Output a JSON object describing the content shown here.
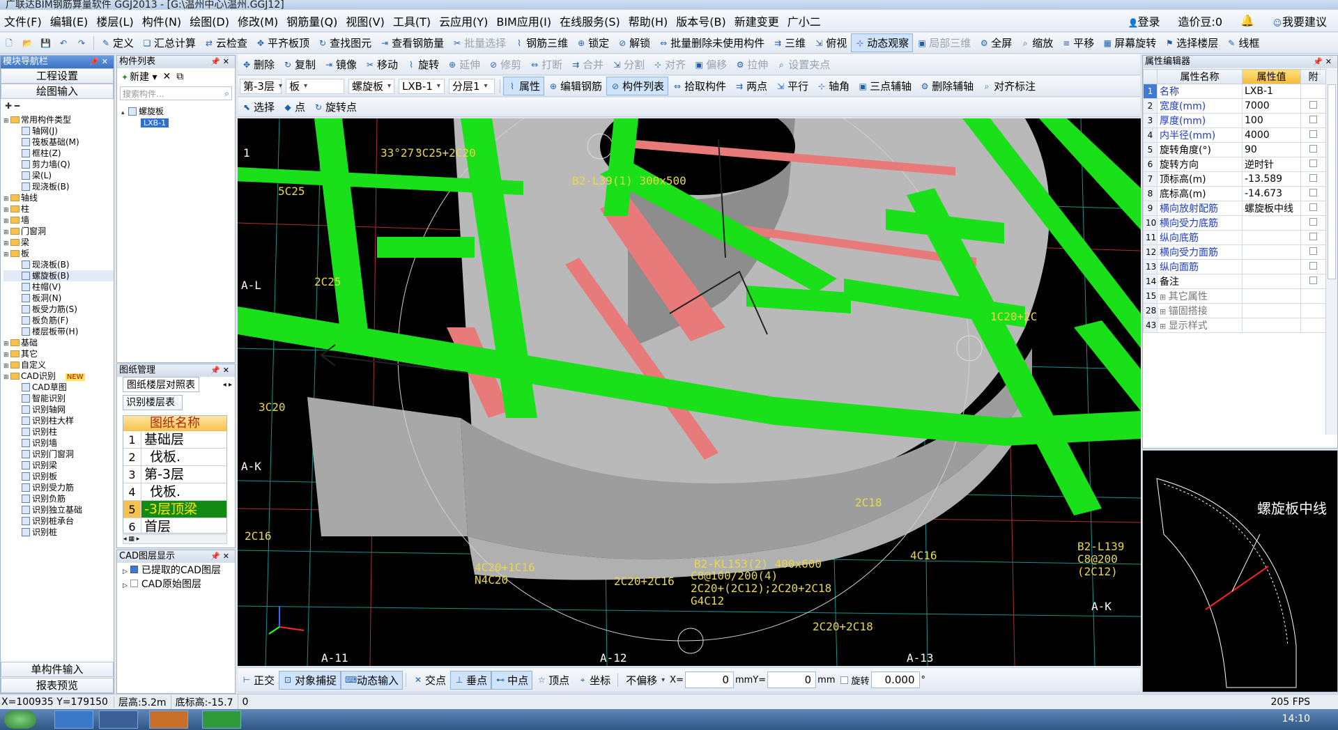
{
  "window": {
    "title": "广联达BIM钢筋算量软件 GGJ2013 - [G:\\温州中心\\温州.GGJ12]"
  },
  "menu": [
    "文件(F)",
    "编辑(E)",
    "楼层(L)",
    "构件(N)",
    "绘图(D)",
    "修改(M)",
    "钢筋量(Q)",
    "视图(V)",
    "工具(T)",
    "云应用(Y)",
    "BIM应用(I)",
    "在线服务(S)",
    "帮助(H)",
    "版本号(B)",
    "新建变更",
    "广小二"
  ],
  "menu_right": {
    "login": "登录",
    "price_bean": "造价豆:0",
    "suggest": "我要建议"
  },
  "toolbar1": [
    "定义",
    "汇总计算",
    "云检查",
    "平齐板顶",
    "查找图元",
    "查看钢筋量",
    "批量选择",
    "钢筋三维",
    "锁定",
    "解锁",
    "批量删除未使用构件",
    "三维",
    "俯视",
    "动态观察",
    "局部三维",
    "全屏",
    "缩放",
    "平移",
    "屏幕旋转",
    "选择楼层",
    "线框"
  ],
  "toolbar2": [
    "删除",
    "复制",
    "镜像",
    "移动",
    "旋转",
    "延伸",
    "修剪",
    "打断",
    "合并",
    "分割",
    "对齐",
    "偏移",
    "拉伸",
    "设置夹点"
  ],
  "toolbar3": {
    "floor": "第-3层",
    "type": "板",
    "subtype": "螺旋板",
    "component": "LXB-1",
    "layer": "分层1",
    "buttons": [
      "属性",
      "编辑钢筋",
      "构件列表",
      "拾取构件",
      "两点",
      "平行",
      "轴角",
      "三点辅轴",
      "删除辅轴",
      "对齐标注"
    ]
  },
  "toolbar4": [
    "选择",
    "点",
    "旋转点"
  ],
  "nav": {
    "title": "模块导航栏",
    "btn1": "工程设置",
    "btn2": "绘图输入",
    "btn3": "单构件输入",
    "btn4": "报表预览",
    "tree": [
      {
        "d": 0,
        "t": "常用构件类型",
        "f": 1
      },
      {
        "d": 1,
        "t": "轴网(J)"
      },
      {
        "d": 1,
        "t": "筏板基础(M)"
      },
      {
        "d": 1,
        "t": "框柱(Z)"
      },
      {
        "d": 1,
        "t": "剪力墙(Q)"
      },
      {
        "d": 1,
        "t": "梁(L)"
      },
      {
        "d": 1,
        "t": "现浇板(B)"
      },
      {
        "d": 0,
        "t": "轴线",
        "f": 1
      },
      {
        "d": 0,
        "t": "柱",
        "f": 1
      },
      {
        "d": 0,
        "t": "墙",
        "f": 1
      },
      {
        "d": 0,
        "t": "门窗洞",
        "f": 1
      },
      {
        "d": 0,
        "t": "梁",
        "f": 1
      },
      {
        "d": 0,
        "t": "板",
        "f": 1
      },
      {
        "d": 1,
        "t": "现浇板(B)"
      },
      {
        "d": 1,
        "t": "螺旋板(B)"
      },
      {
        "d": 1,
        "t": "柱帽(V)"
      },
      {
        "d": 1,
        "t": "板洞(N)"
      },
      {
        "d": 1,
        "t": "板受力筋(S)"
      },
      {
        "d": 1,
        "t": "板负筋(F)"
      },
      {
        "d": 1,
        "t": "楼层板带(H)"
      },
      {
        "d": 0,
        "t": "基础",
        "f": 1
      },
      {
        "d": 0,
        "t": "其它",
        "f": 1
      },
      {
        "d": 0,
        "t": "自定义",
        "f": 1
      },
      {
        "d": 0,
        "t": "CAD识别",
        "f": 1
      },
      {
        "d": 1,
        "t": "CAD草图"
      },
      {
        "d": 1,
        "t": "智能识别"
      },
      {
        "d": 1,
        "t": "识别轴网"
      },
      {
        "d": 1,
        "t": "识别柱大样"
      },
      {
        "d": 1,
        "t": "识别柱"
      },
      {
        "d": 1,
        "t": "识别墙"
      },
      {
        "d": 1,
        "t": "识别门窗洞"
      },
      {
        "d": 1,
        "t": "识别梁"
      },
      {
        "d": 1,
        "t": "识别板"
      },
      {
        "d": 1,
        "t": "识别受力筋"
      },
      {
        "d": 1,
        "t": "识别负筋"
      },
      {
        "d": 1,
        "t": "识别独立基础"
      },
      {
        "d": 1,
        "t": "识别桩承台"
      },
      {
        "d": 1,
        "t": "识别桩"
      }
    ],
    "new_badge": "NEW"
  },
  "complist": {
    "title": "构件列表",
    "new": "新建",
    "search_ph": "搜索构件...",
    "root": "螺旋板",
    "item": "LXB-1"
  },
  "drawings": {
    "title": "图纸管理",
    "tab": "图纸楼层对照表",
    "btn": "识别楼层表",
    "header": "图纸名称",
    "rows": [
      {
        "n": "1",
        "t": "基础层"
      },
      {
        "n": "2",
        "t": "伐板."
      },
      {
        "n": "3",
        "t": "第-3层"
      },
      {
        "n": "4",
        "t": "伐板."
      },
      {
        "n": "5",
        "t": "-3层顶梁"
      },
      {
        "n": "6",
        "t": "首层"
      }
    ]
  },
  "cadlayers": {
    "title": "CAD图层显示",
    "l1": "已提取的CAD图层",
    "l2": "CAD原始图层"
  },
  "props": {
    "title": "属性编辑器",
    "h_name": "属性名称",
    "h_val": "属性值",
    "h_add": "附",
    "rows": [
      {
        "n": "1",
        "k": "名称",
        "v": "LXB-1",
        "c": "blue"
      },
      {
        "n": "2",
        "k": "宽度(mm)",
        "v": "7000",
        "c": "blue"
      },
      {
        "n": "3",
        "k": "厚度(mm)",
        "v": "100",
        "c": "blue"
      },
      {
        "n": "4",
        "k": "内半径(mm)",
        "v": "4000",
        "c": "blue"
      },
      {
        "n": "5",
        "k": "旋转角度(°)",
        "v": "90",
        "c": ""
      },
      {
        "n": "6",
        "k": "旋转方向",
        "v": "逆时针",
        "c": ""
      },
      {
        "n": "7",
        "k": "顶标高(m)",
        "v": "-13.589",
        "c": ""
      },
      {
        "n": "8",
        "k": "底标高(m)",
        "v": "-14.673",
        "c": ""
      },
      {
        "n": "9",
        "k": "横向放射配筋",
        "v": "螺旋板中线",
        "c": "blue"
      },
      {
        "n": "10",
        "k": "横向受力底筋",
        "v": "",
        "c": "blue"
      },
      {
        "n": "11",
        "k": "纵向底筋",
        "v": "",
        "c": "blue"
      },
      {
        "n": "12",
        "k": "横向受力面筋",
        "v": "",
        "c": "blue"
      },
      {
        "n": "13",
        "k": "纵向面筋",
        "v": "",
        "c": "blue"
      },
      {
        "n": "14",
        "k": "备注",
        "v": "",
        "c": ""
      },
      {
        "n": "15",
        "k": "其它属性",
        "v": "",
        "c": "gray",
        "g": 1
      },
      {
        "n": "28",
        "k": "锚固搭接",
        "v": "",
        "c": "gray",
        "g": 1
      },
      {
        "n": "43",
        "k": "显示样式",
        "v": "",
        "c": "gray",
        "g": 1
      }
    ]
  },
  "preview": {
    "label": "螺旋板中线"
  },
  "snapbar": {
    "items": [
      "正交",
      "对象捕捉",
      "动态输入",
      "交点",
      "垂点",
      "中点",
      "顶点",
      "坐标"
    ],
    "offset": "不偏移",
    "x_label": "X=",
    "x_val": "0",
    "mm1": "mm",
    "y_label": "Y=",
    "y_val": "0",
    "mm2": "mm",
    "rot_label": "旋转",
    "rot_val": "0.000",
    "deg": "°"
  },
  "status": {
    "coords": "X=100935 Y=179150",
    "floor_h": "层高:5.2m",
    "base_h": "底标高:-15.7",
    "zero": "0",
    "fps": "205 FPS"
  },
  "viewport": {
    "labels": [
      "33°27'",
      "3C25+2C20",
      "B2-L39(1) 300x500",
      "5C25",
      "2C25",
      "4C20+1C16",
      "N4C20",
      "2C20+2C16",
      "B2-KL153(2) 400x600",
      "C8@100/200(4)",
      "2C20+(2C12);2C20+2C18",
      "G4C12",
      "2C20+2C18",
      "4C16",
      "2C18",
      "B2-L139",
      "C8@200",
      "(2C12)",
      "3C20",
      "1C20+2C",
      "2C16",
      "A-L",
      "A-K",
      "A-11",
      "A-12",
      "A-13",
      "A-K",
      "1"
    ]
  },
  "taskbar": {
    "time": "14:10"
  }
}
